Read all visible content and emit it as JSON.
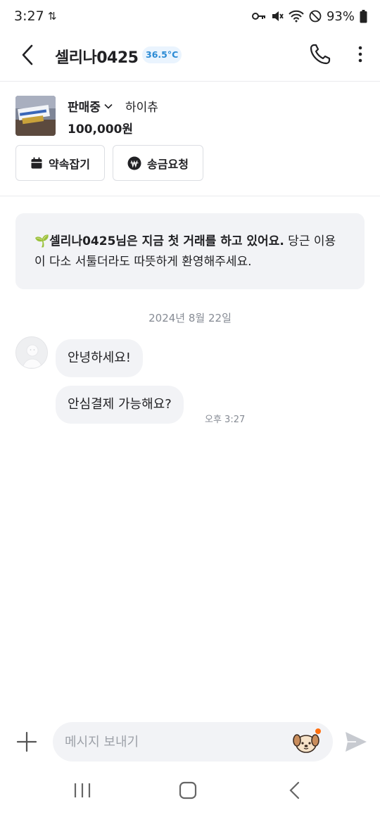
{
  "status_bar": {
    "time": "3:27",
    "battery_percent": "93%",
    "icons": [
      "sync-icon",
      "key-icon",
      "mute-icon",
      "wifi-icon",
      "do-not-disturb-icon",
      "battery-icon"
    ]
  },
  "header": {
    "title": "셀리나0425",
    "manner_temperature": "36.5°C",
    "icons": [
      "back-arrow-icon",
      "phone-icon",
      "more-vertical-icon"
    ]
  },
  "product": {
    "status": "판매중",
    "name": "하이츄",
    "price": "100,000원",
    "buttons": {
      "appointment": "약속잡기",
      "transfer_request": "송금요청"
    }
  },
  "notice": {
    "emoji": "🌱",
    "bold_text": "셀리나0425님은 지금 첫 거래를 하고 있어요.",
    "text": " 당근 이용이 다소 서툴더라도 따뜻하게 환영해주세요."
  },
  "conversation": {
    "date": "2024년 8월 22일",
    "messages": [
      {
        "text": "안녕하세요!"
      },
      {
        "text": "안심결제 가능해요?",
        "time": "오후 3:27"
      }
    ]
  },
  "composer": {
    "placeholder": "메시지 보내기",
    "value": ""
  },
  "colors": {
    "brand_orange": "#ff6f0f",
    "temperature_blue": "#2a8ad4",
    "bubble_bg": "#f2f3f6"
  }
}
